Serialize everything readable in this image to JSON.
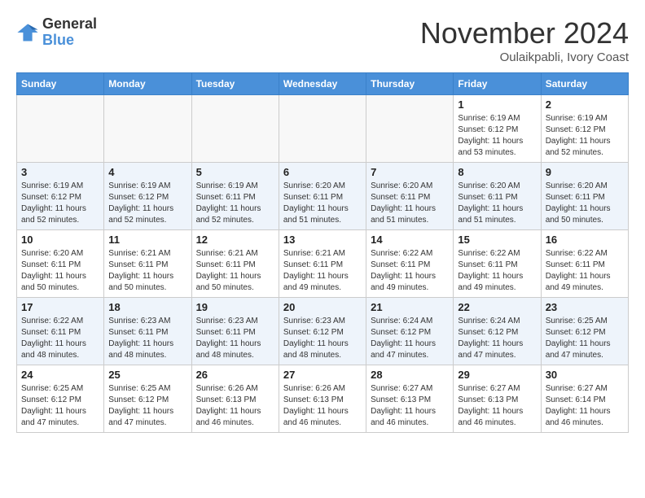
{
  "header": {
    "logo_line1": "General",
    "logo_line2": "Blue",
    "month": "November 2024",
    "location": "Oulaikpabli, Ivory Coast"
  },
  "weekdays": [
    "Sunday",
    "Monday",
    "Tuesday",
    "Wednesday",
    "Thursday",
    "Friday",
    "Saturday"
  ],
  "weeks": [
    [
      {
        "day": "",
        "info": ""
      },
      {
        "day": "",
        "info": ""
      },
      {
        "day": "",
        "info": ""
      },
      {
        "day": "",
        "info": ""
      },
      {
        "day": "",
        "info": ""
      },
      {
        "day": "1",
        "info": "Sunrise: 6:19 AM\nSunset: 6:12 PM\nDaylight: 11 hours\nand 53 minutes."
      },
      {
        "day": "2",
        "info": "Sunrise: 6:19 AM\nSunset: 6:12 PM\nDaylight: 11 hours\nand 52 minutes."
      }
    ],
    [
      {
        "day": "3",
        "info": "Sunrise: 6:19 AM\nSunset: 6:12 PM\nDaylight: 11 hours\nand 52 minutes."
      },
      {
        "day": "4",
        "info": "Sunrise: 6:19 AM\nSunset: 6:12 PM\nDaylight: 11 hours\nand 52 minutes."
      },
      {
        "day": "5",
        "info": "Sunrise: 6:19 AM\nSunset: 6:11 PM\nDaylight: 11 hours\nand 52 minutes."
      },
      {
        "day": "6",
        "info": "Sunrise: 6:20 AM\nSunset: 6:11 PM\nDaylight: 11 hours\nand 51 minutes."
      },
      {
        "day": "7",
        "info": "Sunrise: 6:20 AM\nSunset: 6:11 PM\nDaylight: 11 hours\nand 51 minutes."
      },
      {
        "day": "8",
        "info": "Sunrise: 6:20 AM\nSunset: 6:11 PM\nDaylight: 11 hours\nand 51 minutes."
      },
      {
        "day": "9",
        "info": "Sunrise: 6:20 AM\nSunset: 6:11 PM\nDaylight: 11 hours\nand 50 minutes."
      }
    ],
    [
      {
        "day": "10",
        "info": "Sunrise: 6:20 AM\nSunset: 6:11 PM\nDaylight: 11 hours\nand 50 minutes."
      },
      {
        "day": "11",
        "info": "Sunrise: 6:21 AM\nSunset: 6:11 PM\nDaylight: 11 hours\nand 50 minutes."
      },
      {
        "day": "12",
        "info": "Sunrise: 6:21 AM\nSunset: 6:11 PM\nDaylight: 11 hours\nand 50 minutes."
      },
      {
        "day": "13",
        "info": "Sunrise: 6:21 AM\nSunset: 6:11 PM\nDaylight: 11 hours\nand 49 minutes."
      },
      {
        "day": "14",
        "info": "Sunrise: 6:22 AM\nSunset: 6:11 PM\nDaylight: 11 hours\nand 49 minutes."
      },
      {
        "day": "15",
        "info": "Sunrise: 6:22 AM\nSunset: 6:11 PM\nDaylight: 11 hours\nand 49 minutes."
      },
      {
        "day": "16",
        "info": "Sunrise: 6:22 AM\nSunset: 6:11 PM\nDaylight: 11 hours\nand 49 minutes."
      }
    ],
    [
      {
        "day": "17",
        "info": "Sunrise: 6:22 AM\nSunset: 6:11 PM\nDaylight: 11 hours\nand 48 minutes."
      },
      {
        "day": "18",
        "info": "Sunrise: 6:23 AM\nSunset: 6:11 PM\nDaylight: 11 hours\nand 48 minutes."
      },
      {
        "day": "19",
        "info": "Sunrise: 6:23 AM\nSunset: 6:11 PM\nDaylight: 11 hours\nand 48 minutes."
      },
      {
        "day": "20",
        "info": "Sunrise: 6:23 AM\nSunset: 6:12 PM\nDaylight: 11 hours\nand 48 minutes."
      },
      {
        "day": "21",
        "info": "Sunrise: 6:24 AM\nSunset: 6:12 PM\nDaylight: 11 hours\nand 47 minutes."
      },
      {
        "day": "22",
        "info": "Sunrise: 6:24 AM\nSunset: 6:12 PM\nDaylight: 11 hours\nand 47 minutes."
      },
      {
        "day": "23",
        "info": "Sunrise: 6:25 AM\nSunset: 6:12 PM\nDaylight: 11 hours\nand 47 minutes."
      }
    ],
    [
      {
        "day": "24",
        "info": "Sunrise: 6:25 AM\nSunset: 6:12 PM\nDaylight: 11 hours\nand 47 minutes."
      },
      {
        "day": "25",
        "info": "Sunrise: 6:25 AM\nSunset: 6:12 PM\nDaylight: 11 hours\nand 47 minutes."
      },
      {
        "day": "26",
        "info": "Sunrise: 6:26 AM\nSunset: 6:13 PM\nDaylight: 11 hours\nand 46 minutes."
      },
      {
        "day": "27",
        "info": "Sunrise: 6:26 AM\nSunset: 6:13 PM\nDaylight: 11 hours\nand 46 minutes."
      },
      {
        "day": "28",
        "info": "Sunrise: 6:27 AM\nSunset: 6:13 PM\nDaylight: 11 hours\nand 46 minutes."
      },
      {
        "day": "29",
        "info": "Sunrise: 6:27 AM\nSunset: 6:13 PM\nDaylight: 11 hours\nand 46 minutes."
      },
      {
        "day": "30",
        "info": "Sunrise: 6:27 AM\nSunset: 6:14 PM\nDaylight: 11 hours\nand 46 minutes."
      }
    ]
  ]
}
